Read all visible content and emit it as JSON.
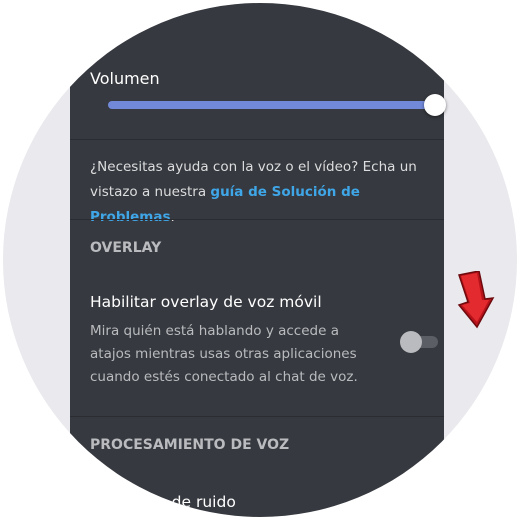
{
  "volume": {
    "label": "Volumen",
    "level": 1.0,
    "accent_color": "#7289da"
  },
  "help": {
    "text_before": "¿Necesitas ayuda con la voz o el vídeo? Echa un vistazo a nuestra ",
    "link_text": "guía de Solución de Problemas",
    "text_after": ".",
    "link_color": "#3fa6e8"
  },
  "overlay": {
    "header": "OVERLAY",
    "setting_title": "Habilitar overlay de voz móvil",
    "setting_description": "Mira quién está hablando y accede a atajos mientras usas otras aplicaciones cuando estés conectado al chat de voz.",
    "toggle_on": false
  },
  "voice_processing": {
    "header": "PROCESAMIENTO DE VOZ",
    "partial_item": "ón de ruido"
  },
  "annotation": {
    "icon": "arrow-down-icon",
    "color": "#d42a2a"
  }
}
